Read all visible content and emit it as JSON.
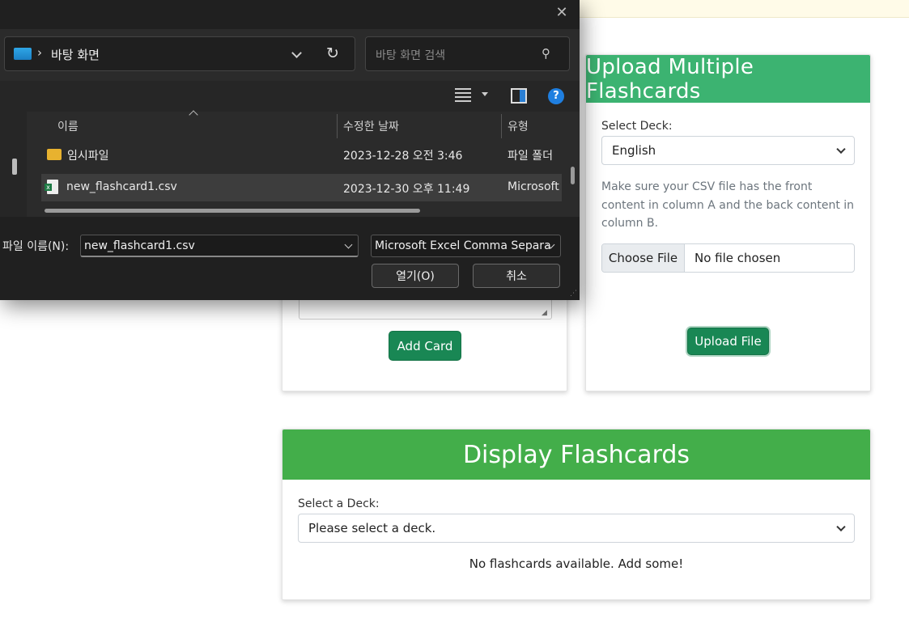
{
  "dialog": {
    "address": "바탕 화면",
    "search_placeholder": "바탕 화면 검색",
    "columns": {
      "name": "이름",
      "modified": "수정한 날짜",
      "type": "유형"
    },
    "files": [
      {
        "name": "임시파일",
        "modified": "2023-12-28 오전 3:46",
        "type": "파일 폴더",
        "icon": "folder-icon",
        "selected": false
      },
      {
        "name": "new_flashcard1.csv",
        "modified": "2023-12-30 오후 11:49",
        "type": "Microsoft",
        "icon": "csv-file-icon",
        "selected": true
      }
    ],
    "filename_label": "파일 이름(N):",
    "filename_value": "new_flashcard1.csv",
    "filetype_value": "Microsoft Excel Comma Separa",
    "open_label": "열기(O)",
    "cancel_label": "취소"
  },
  "add_card": {
    "button_label": "Add Card"
  },
  "upload": {
    "title": "Upload Multiple Flashcards",
    "select_label": "Select Deck:",
    "select_value": "English",
    "help": "Make sure your CSV file has the front content in column A and the back content in column B.",
    "choose_file_label": "Choose File",
    "file_status": "No file chosen",
    "button_label": "Upload File"
  },
  "display": {
    "title": "Display Flashcards",
    "select_label": "Select a Deck:",
    "select_value": "Please select a deck.",
    "empty_message": "No flashcards available. Add some!"
  },
  "colors": {
    "header_green": "#3cb371",
    "button_green": "#198754",
    "dialog_bg": "#2b2b2b"
  }
}
